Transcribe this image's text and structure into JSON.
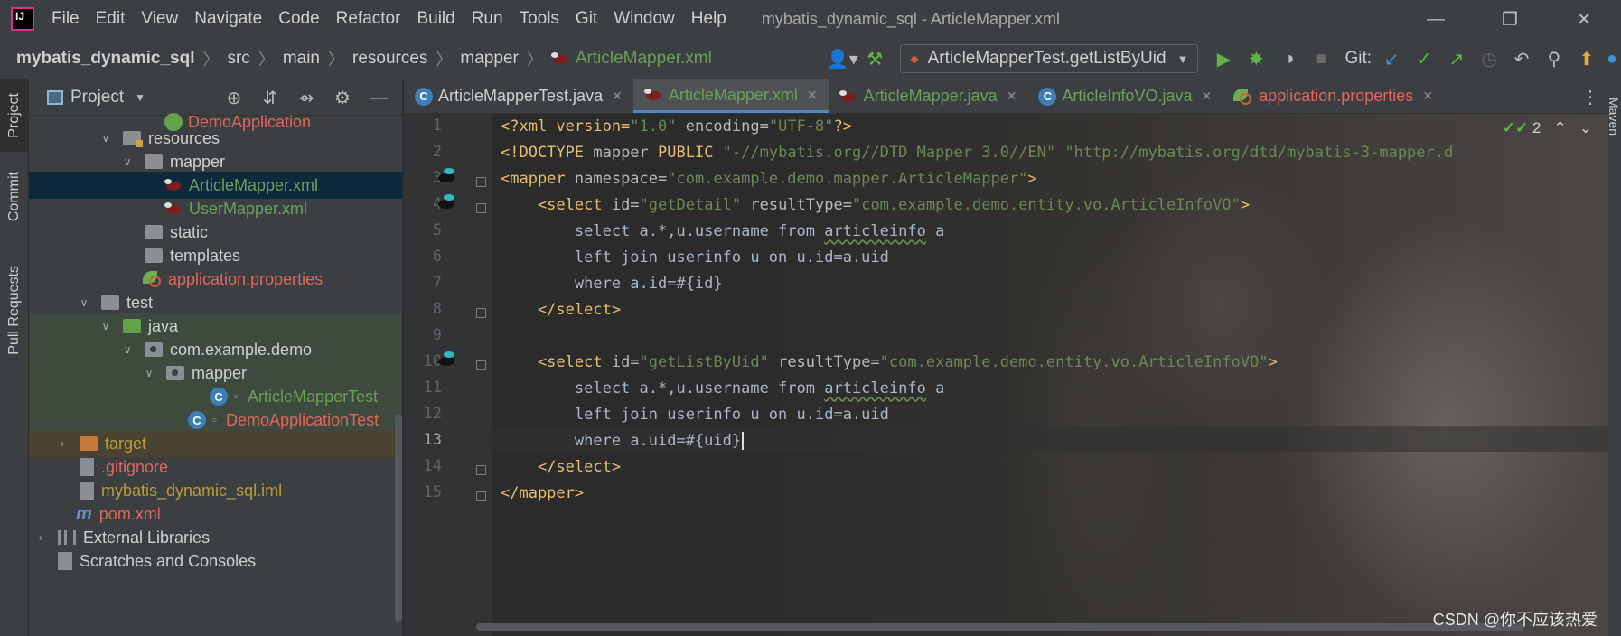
{
  "menubar": {
    "items": [
      {
        "label": "File"
      },
      {
        "label": "Edit"
      },
      {
        "label": "View"
      },
      {
        "label": "Navigate"
      },
      {
        "label": "Code"
      },
      {
        "label": "Refactor"
      },
      {
        "label": "Build"
      },
      {
        "label": "Run"
      },
      {
        "label": "Tools"
      },
      {
        "label": "Git"
      },
      {
        "label": "Window"
      },
      {
        "label": "Help"
      }
    ],
    "window_title": "mybatis_dynamic_sql - ArticleMapper.xml"
  },
  "navbar": {
    "breadcrumbs": [
      "mybatis_dynamic_sql",
      "src",
      "main",
      "resources",
      "mapper",
      "ArticleMapper.xml"
    ],
    "run_config": "ArticleMapperTest.getListByUid",
    "git_label": "Git:"
  },
  "left_strip": {
    "tabs": [
      "Project",
      "Commit",
      "Pull Requests"
    ]
  },
  "project_panel": {
    "title": "Project",
    "tree": [
      {
        "label": "DemoApplication"
      },
      {
        "label": "resources"
      },
      {
        "label": "mapper"
      },
      {
        "label": "ArticleMapper.xml"
      },
      {
        "label": "UserMapper.xml"
      },
      {
        "label": "static"
      },
      {
        "label": "templates"
      },
      {
        "label": "application.properties"
      },
      {
        "label": "test"
      },
      {
        "label": "java"
      },
      {
        "label": "com.example.demo"
      },
      {
        "label": "mapper"
      },
      {
        "label": "ArticleMapperTest"
      },
      {
        "label": "DemoApplicationTest"
      },
      {
        "label": "target"
      },
      {
        "label": ".gitignore"
      },
      {
        "label": "mybatis_dynamic_sql.iml"
      },
      {
        "label": "pom.xml"
      },
      {
        "label": "External Libraries"
      },
      {
        "label": "Scratches and Consoles"
      }
    ]
  },
  "editor": {
    "tabs": [
      {
        "label": "ArticleMapperTest.java"
      },
      {
        "label": "ArticleMapper.xml"
      },
      {
        "label": "ArticleMapper.java"
      },
      {
        "label": "ArticleInfoVO.java"
      },
      {
        "label": "application.properties"
      }
    ],
    "line_numbers": [
      "1",
      "2",
      "3",
      "4",
      "5",
      "6",
      "7",
      "8",
      "9",
      "10",
      "11",
      "12",
      "13",
      "14",
      "15"
    ],
    "inspection_count": "2",
    "code": {
      "l1_a": "<?xml version=",
      "l1_b": "\"1.0\"",
      "l1_c": " encoding=",
      "l1_d": "\"UTF-8\"",
      "l1_e": "?>",
      "l2_a": "<!DOCTYPE",
      "l2_b": " mapper ",
      "l2_c": "PUBLIC",
      "l2_d": " \"-//mybatis.org//DTD Mapper 3.0//EN\" \"http://mybatis.org/dtd/mybatis-3-mapper.d",
      "l3_a": "<mapper ",
      "l3_b": "namespace=",
      "l3_c": "\"com.example.demo.mapper.ArticleMapper\"",
      "l3_d": ">",
      "l4_a": "    <select ",
      "l4_b": "id=",
      "l4_c": "\"getDetail\"",
      "l4_d": " resultType=",
      "l4_e": "\"com.example.demo.entity.vo.ArticleInfoVO\"",
      "l4_f": ">",
      "l5_a": "        select a.*,u.username from ",
      "l5_b": "articleinfo",
      "l5_c": " a",
      "l6": "        left join userinfo u on u.id=a.uid",
      "l7": "        where a.id=#{id}",
      "l8": "    </select>",
      "l10_a": "    <select ",
      "l10_b": "id=",
      "l10_c": "\"getListByUid\"",
      "l10_d": " resultType=",
      "l10_e": "\"com.example.demo.entity.vo.ArticleInfoVO\"",
      "l10_f": ">",
      "l11_a": "        select a.*,u.username from ",
      "l11_b": "articleinfo",
      "l11_c": " a",
      "l12": "        left join userinfo u on u.id=a.uid",
      "l13": "        where a.uid=#{uid}",
      "l14": "    </select>",
      "l15": "</mapper>"
    },
    "watermark": "CSDN @你不应该热爱"
  },
  "right_strip": {
    "label": "Maven"
  }
}
